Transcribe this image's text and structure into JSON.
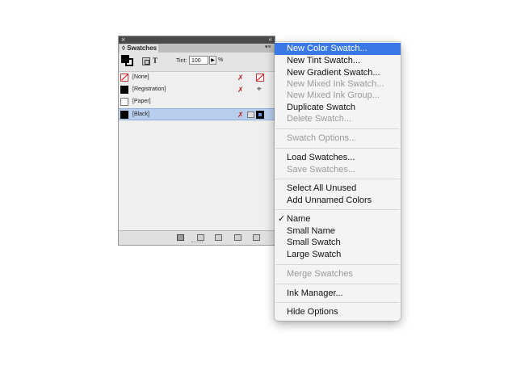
{
  "panel": {
    "close_glyph": "×",
    "collapse_glyph": "«",
    "tab_label": "Swatches",
    "tab_glyph": "◊",
    "menu_glyph": "▾≡",
    "tint_label": "Tint:",
    "tint_value": "100",
    "tint_arrow": "▶",
    "tint_unit": "%",
    "text_glyph": "T",
    "swatches": [
      {
        "name": "[None]",
        "chip": "none"
      },
      {
        "name": "[Registration]",
        "chip": "black"
      },
      {
        "name": "[Paper]",
        "chip": "white"
      },
      {
        "name": "[Black]",
        "chip": "black",
        "selected": true
      }
    ],
    "icons": {
      "no_edit": "✗",
      "registration": "⌖"
    }
  },
  "menu": {
    "items": [
      {
        "label": "New Color Swatch...",
        "state": "highlighted"
      },
      {
        "label": "New Tint Swatch...",
        "state": "enabled"
      },
      {
        "label": "New Gradient Swatch...",
        "state": "enabled"
      },
      {
        "label": "New Mixed Ink Swatch...",
        "state": "disabled"
      },
      {
        "label": "New Mixed Ink Group...",
        "state": "disabled"
      },
      {
        "label": "Duplicate Swatch",
        "state": "enabled"
      },
      {
        "label": "Delete Swatch...",
        "state": "disabled"
      },
      {
        "label": "Swatch Options...",
        "state": "disabled"
      },
      {
        "label": "Load Swatches...",
        "state": "enabled"
      },
      {
        "label": "Save Swatches...",
        "state": "disabled"
      },
      {
        "label": "Select All Unused",
        "state": "enabled"
      },
      {
        "label": "Add Unnamed Colors",
        "state": "enabled"
      },
      {
        "label": "Name",
        "state": "checked"
      },
      {
        "label": "Small Name",
        "state": "enabled"
      },
      {
        "label": "Small Swatch",
        "state": "enabled"
      },
      {
        "label": "Large Swatch",
        "state": "enabled"
      },
      {
        "label": "Merge Swatches",
        "state": "disabled"
      },
      {
        "label": "Ink Manager...",
        "state": "enabled"
      },
      {
        "label": "Hide Options",
        "state": "enabled"
      }
    ],
    "check_glyph": "✓"
  },
  "colors": {
    "highlight": "#3a78e6",
    "selected_row": "#b7cfec"
  }
}
